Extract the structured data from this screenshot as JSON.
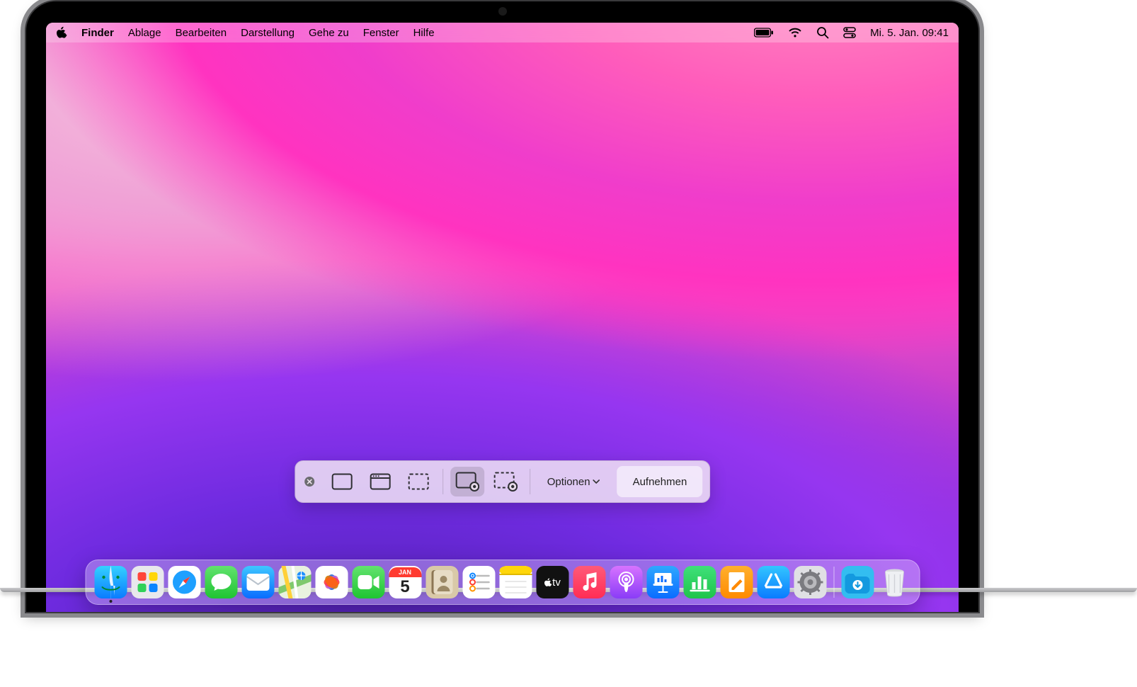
{
  "menubar": {
    "app_name": "Finder",
    "items": [
      "Ablage",
      "Bearbeiten",
      "Darstellung",
      "Gehe zu",
      "Fenster",
      "Hilfe"
    ],
    "date_time": "Mi. 5. Jan.  09:41"
  },
  "screenshot_toolbar": {
    "close": "close",
    "buttons": {
      "capture_entire_screen": "capture-entire-screen",
      "capture_window": "capture-window",
      "capture_selection": "capture-selection",
      "record_entire_screen": "record-entire-screen",
      "record_selection": "record-selection"
    },
    "options_label": "Optionen",
    "record_label": "Aufnehmen"
  },
  "dock": {
    "items": [
      {
        "name": "finder",
        "label": "Finder"
      },
      {
        "name": "launchpad",
        "label": "Launchpad"
      },
      {
        "name": "safari",
        "label": "Safari"
      },
      {
        "name": "messages",
        "label": "Nachrichten"
      },
      {
        "name": "mail",
        "label": "Mail"
      },
      {
        "name": "maps",
        "label": "Karten"
      },
      {
        "name": "photos",
        "label": "Fotos"
      },
      {
        "name": "facetime",
        "label": "FaceTime"
      },
      {
        "name": "calendar",
        "label": "Kalender",
        "text_top": "JAN",
        "text_num": "5"
      },
      {
        "name": "contacts",
        "label": "Kontakte"
      },
      {
        "name": "reminders",
        "label": "Erinnerungen"
      },
      {
        "name": "notes",
        "label": "Notizen"
      },
      {
        "name": "tv",
        "label": "TV"
      },
      {
        "name": "music",
        "label": "Musik"
      },
      {
        "name": "podcasts",
        "label": "Podcasts"
      },
      {
        "name": "keynote",
        "label": "Keynote"
      },
      {
        "name": "numbers",
        "label": "Numbers"
      },
      {
        "name": "pages",
        "label": "Pages"
      },
      {
        "name": "appstore",
        "label": "App Store"
      },
      {
        "name": "settings",
        "label": "Systemeinstellungen"
      }
    ],
    "right_items": [
      {
        "name": "downloads",
        "label": "Downloads"
      },
      {
        "name": "trash",
        "label": "Papierkorb"
      }
    ]
  }
}
